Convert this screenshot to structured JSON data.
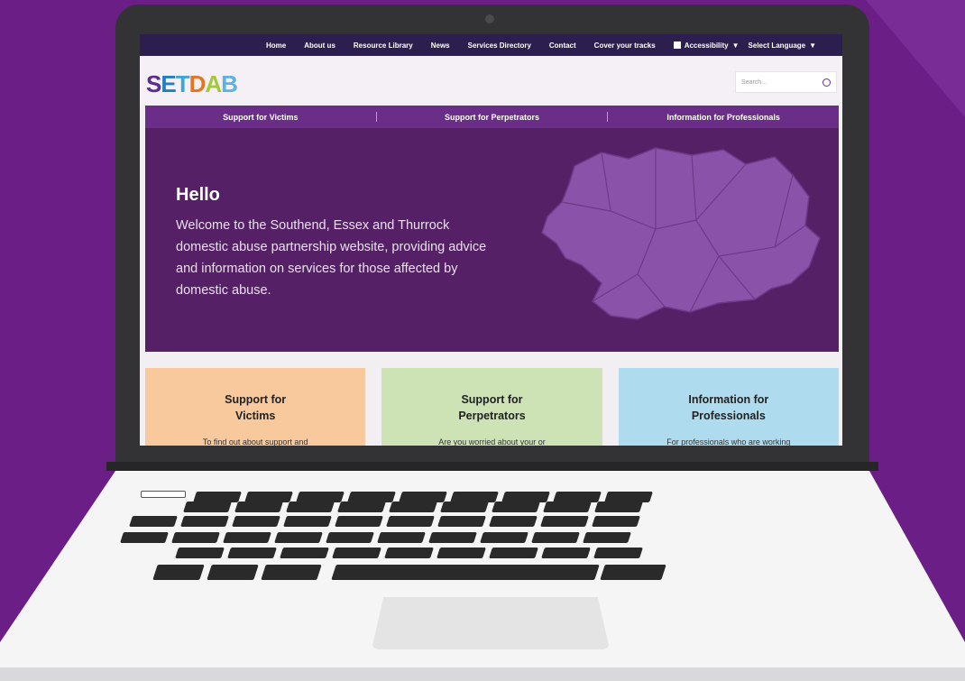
{
  "topnav": {
    "links": [
      "Home",
      "About us",
      "Resource Library",
      "News",
      "Services Directory",
      "Contact",
      "Cover your tracks"
    ],
    "accessibility": "Accessibility",
    "language": "Select Language"
  },
  "logo": {
    "s": "S",
    "e": "E",
    "t": "T",
    "d": "D",
    "a": "A",
    "b": "B"
  },
  "search": {
    "placeholder": "Search..."
  },
  "mainnav": [
    "Support for Victims",
    "Support for Perpetrators",
    "Information for Professionals"
  ],
  "hero": {
    "title": "Hello",
    "text": "Welcome to the Southend, Essex and Thurrock domestic abuse partnership website, providing advice and information on services for those affected by domestic abuse."
  },
  "cards": [
    {
      "title": "Support for Victims",
      "text": "To find out about support and"
    },
    {
      "title": "Support for Perpetrators",
      "text": "Are you worried about your or"
    },
    {
      "title": "Information for Professionals",
      "text": "For professionals who are working"
    }
  ],
  "colors": {
    "background": "#6a1e86",
    "brand_purple": "#552065",
    "card_victims": "#f7c99c",
    "card_perpetrators": "#cde3b6",
    "card_professionals": "#aedcee"
  }
}
